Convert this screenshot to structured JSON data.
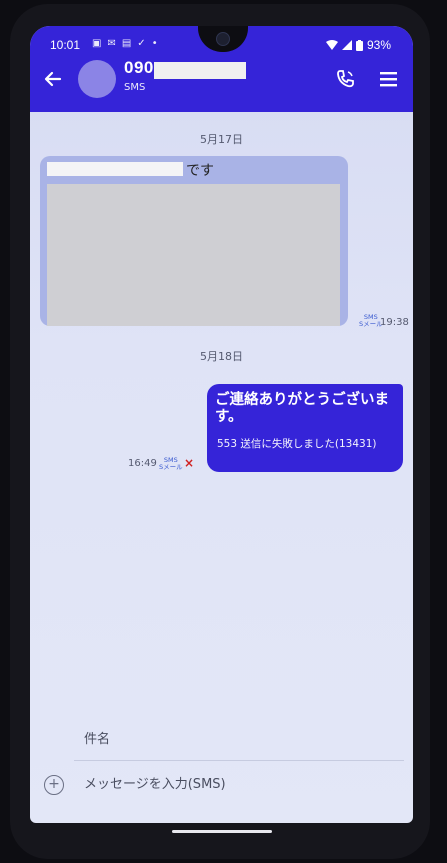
{
  "status_bar": {
    "time": "10:01",
    "left_icons": [
      "notification-icon",
      "notification-icon",
      "notification-icon",
      "check-icon",
      "dot-icon"
    ],
    "battery": "93%"
  },
  "header": {
    "contact_number": "090",
    "contact_type": "SMS",
    "accent_color": "#3524d8"
  },
  "messages": {
    "date_1": "5月17日",
    "incoming_suffix": "です",
    "incoming_badge_1": "SMS",
    "incoming_badge_2": "Sメール",
    "incoming_time": "19:38",
    "date_2": "5月18日",
    "outgoing_text": "ご連絡ありがとうございます。",
    "outgoing_error": "553 送信に失敗しました(13431)",
    "outgoing_badge_1": "SMS",
    "outgoing_badge_2": "Sメール",
    "outgoing_time": "16:49",
    "fail_mark": "×"
  },
  "compose": {
    "subject_label": "件名",
    "input_placeholder": "メッセージを入力(SMS)",
    "add_symbol": "+"
  }
}
